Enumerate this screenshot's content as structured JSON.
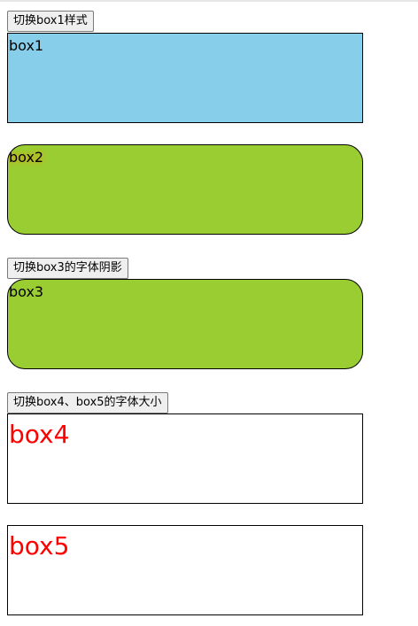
{
  "buttons": {
    "toggle_box1": "切换box1样式",
    "toggle_box3": "切换box3的字体阴影",
    "toggle_box4_box5": "切换box4、box5的字体大小"
  },
  "boxes": {
    "box1": {
      "label": "box1",
      "background": "#87ceeb"
    },
    "box2": {
      "label": "box2",
      "background": "#9acd32"
    },
    "box3": {
      "label": "box3",
      "background": "#9acd32"
    },
    "box4": {
      "label": "box4",
      "text_color": "#ff0000"
    },
    "box5": {
      "label": "box5",
      "text_color": "#ff0000"
    }
  }
}
